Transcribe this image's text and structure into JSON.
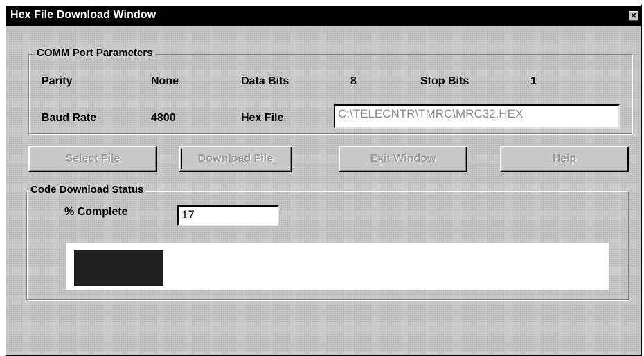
{
  "window": {
    "title": "Hex File Download Window",
    "close_glyph": "✕"
  },
  "comm_params": {
    "legend": "COMM Port Parameters",
    "parity_label": "Parity",
    "parity_value": "None",
    "data_bits_label": "Data Bits",
    "data_bits_value": "8",
    "stop_bits_label": "Stop Bits",
    "stop_bits_value": "1",
    "baud_rate_label": "Baud Rate",
    "baud_rate_value": "4800",
    "hex_file_label": "Hex File",
    "hex_file_value": "C:\\TELECNTR\\TMRC\\MRC32.HEX"
  },
  "buttons": {
    "select_file": "Select File",
    "download_file": "Download File",
    "exit_window": "Exit Window",
    "help": "Help"
  },
  "status": {
    "legend": "Code Download Status",
    "percent_label": "% Complete",
    "percent_value": "17",
    "progress_fraction": 0.17
  },
  "colors": {
    "window_bg": "#c8c8c8",
    "titlebar": "#000000",
    "progress_fill": "#202020"
  }
}
